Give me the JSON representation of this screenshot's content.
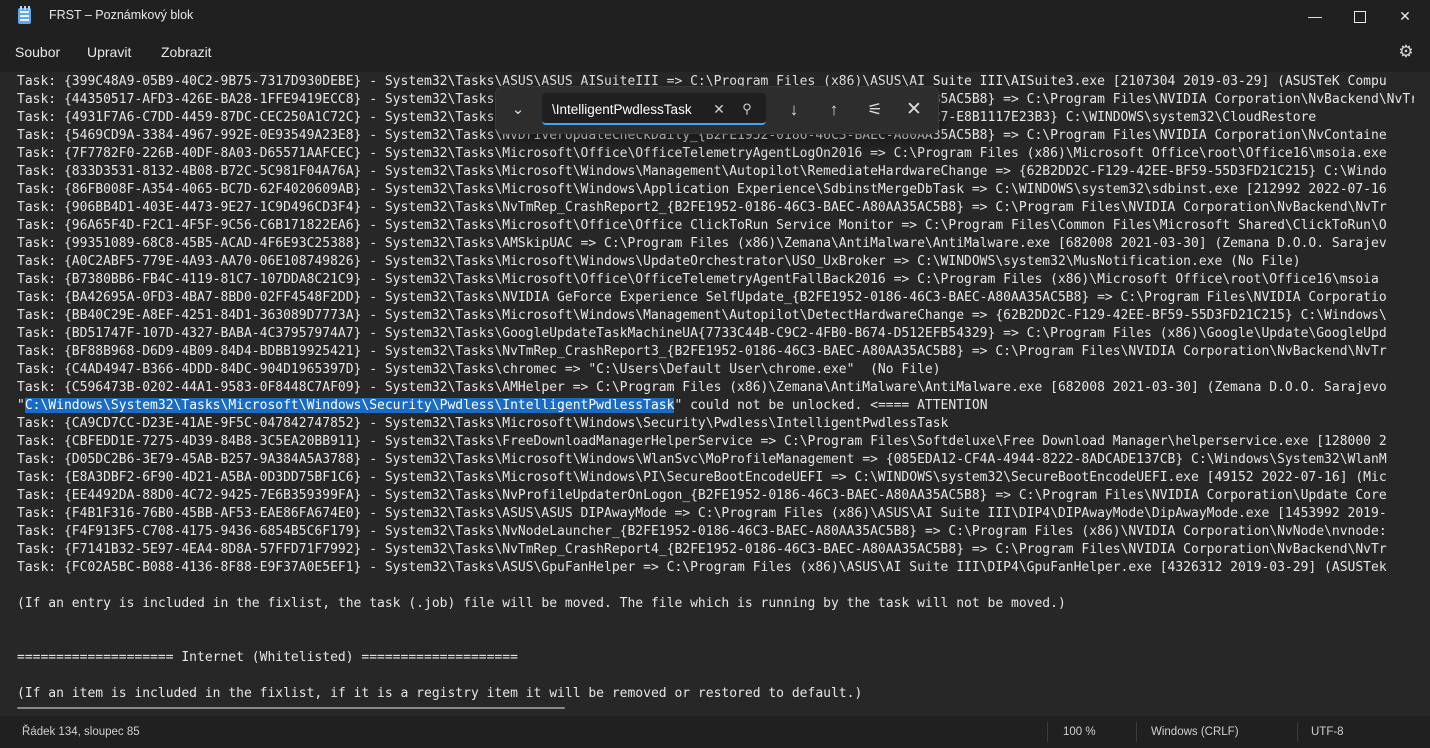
{
  "window": {
    "title": "FRST – Poznámkový blok",
    "minimize_glyph": "—",
    "close_glyph": "✕",
    "icon": "notepad-icon"
  },
  "menu": {
    "file": "Soubor",
    "edit": "Upravit",
    "view": "Zobrazit",
    "settings_icon": "gear-icon"
  },
  "find": {
    "value": "\\IntelligentPwdlessTask",
    "clear_glyph": "✕",
    "search_glyph": "⚲",
    "expand_glyph": "⌄",
    "next_glyph": "↓",
    "prev_glyph": "↑",
    "options_glyph": "⚟",
    "close_glyph": "✕"
  },
  "editor": {
    "lines": [
      "Task: {399C48A9-05B9-40C2-9B75-7317D930DEBE} - System32\\Tasks\\ASUS\\ASUS AISuiteIII => C:\\Program Files (x86)\\ASUS\\AI Suite III\\AISuite3.exe [2107304 2019-03-29] (ASUSTeK Compu",
      "Task: {44350517-AFD3-426E-BA28-1FFE9419ECC8} - System32\\Tasks\\NvDriverUpdateCheckDaily_{B2FE1952-0186-46C3-BAEC-A80AA35AC5B8} => C:\\Program Files\\NVIDIA Corporation\\NvBackend\\NvTr",
      "Task: {4931F7A6-C7DD-4459-87DC-CEC250A1C72C} - System32\\Tasks\\Microsoft\\Windows\\Management\\Provisioning\\{C48D-46B8-BF27-E8B1117E23B3} C:\\WINDOWS\\system32\\CloudRestore",
      "Task: {5469CD9A-3384-4967-992E-0E93549A23E8} - System32\\Tasks\\NvDriverUpdateCheckDaily_{B2FE1952-0186-46C3-BAEC-A80AA35AC5B8} => C:\\Program Files\\NVIDIA Corporation\\NvContaine",
      "Task: {7F7782F0-226B-40DF-8A03-D65571AAFCEC} - System32\\Tasks\\Microsoft\\Office\\OfficeTelemetryAgentLogOn2016 => C:\\Program Files (x86)\\Microsoft Office\\root\\Office16\\msoia.exe",
      "Task: {833D3531-8132-4B08-B72C-5C981F04A76A} - System32\\Tasks\\Microsoft\\Windows\\Management\\Autopilot\\RemediateHardwareChange => {62B2DD2C-F129-42EE-BF59-55D3FD21C215} C:\\Windo",
      "Task: {86FB008F-A354-4065-BC7D-62F4020609AB} - System32\\Tasks\\Microsoft\\Windows\\Application Experience\\SdbinstMergeDbTask => C:\\WINDOWS\\system32\\sdbinst.exe [212992 2022-07-16",
      "Task: {906BB4D1-403E-4473-9E27-1C9D496CD3F4} - System32\\Tasks\\NvTmRep_CrashReport2_{B2FE1952-0186-46C3-BAEC-A80AA35AC5B8} => C:\\Program Files\\NVIDIA Corporation\\NvBackend\\NvTr",
      "Task: {96A65F4D-F2C1-4F5F-9C56-C6B171822EA6} - System32\\Tasks\\Microsoft\\Office\\Office ClickToRun Service Monitor => C:\\Program Files\\Common Files\\Microsoft Shared\\ClickToRun\\O",
      "Task: {99351089-68C8-45B5-ACAD-4F6E93C25388} - System32\\Tasks\\AMSkipUAC => C:\\Program Files (x86)\\Zemana\\AntiMalware\\AntiMalware.exe [682008 2021-03-30] (Zemana D.O.O. Sarajev",
      "Task: {A0C2ABF5-779E-4A93-AA70-06E108749826} - System32\\Tasks\\Microsoft\\Windows\\UpdateOrchestrator\\USO_UxBroker => C:\\WINDOWS\\system32\\MusNotification.exe (No File)",
      "Task: {B7380BB6-FB4C-4119-81C7-107DDA8C21C9} - System32\\Tasks\\Microsoft\\Office\\OfficeTelemetryAgentFallBack2016 => C:\\Program Files (x86)\\Microsoft Office\\root\\Office16\\msoia",
      "Task: {BA42695A-0FD3-4BA7-8BD0-02FF4548F2DD} - System32\\Tasks\\NVIDIA GeForce Experience SelfUpdate_{B2FE1952-0186-46C3-BAEC-A80AA35AC5B8} => C:\\Program Files\\NVIDIA Corporatio",
      "Task: {BB40C29E-A8EF-4251-84D1-363089D7773A} - System32\\Tasks\\Microsoft\\Windows\\Management\\Autopilot\\DetectHardwareChange => {62B2DD2C-F129-42EE-BF59-55D3FD21C215} C:\\Windows\\",
      "Task: {BD51747F-107D-4327-BABA-4C37957974A7} - System32\\Tasks\\GoogleUpdateTaskMachineUA{7733C44B-C9C2-4FB0-B674-D512EFB54329} => C:\\Program Files (x86)\\Google\\Update\\GoogleUpd",
      "Task: {BF88B968-D6D9-4B09-84D4-BDBB19925421} - System32\\Tasks\\NvTmRep_CrashReport3_{B2FE1952-0186-46C3-BAEC-A80AA35AC5B8} => C:\\Program Files\\NVIDIA Corporation\\NvBackend\\NvTr",
      "Task: {C4AD4947-B366-4DDD-84DC-904D1965397D} - System32\\Tasks\\chromec => \"C:\\Users\\Default User\\chrome.exe\"  (No File)",
      "Task: {C596473B-0202-44A1-9583-0F8448C7AF09} - System32\\Tasks\\AMHelper => C:\\Program Files (x86)\\Zemana\\AntiMalware\\AntiMalware.exe [682008 2021-03-30] (Zemana D.O.O. Sarajevo",
      "HIGHLIGHT",
      "Task: {CA9CD7CC-D23E-41AE-9F5C-047842747852} - System32\\Tasks\\Microsoft\\Windows\\Security\\Pwdless\\IntelligentPwdlessTask",
      "Task: {CBFEDD1E-7275-4D39-84B8-3C5EA20BB911} - System32\\Tasks\\FreeDownloadManagerHelperService => C:\\Program Files\\Softdeluxe\\Free Download Manager\\helperservice.exe [128000 2",
      "Task: {D05DC2B6-3E79-45AB-B257-9A384A5A3788} - System32\\Tasks\\Microsoft\\Windows\\WlanSvc\\MoProfileManagement => {085EDA12-CF4A-4944-8222-8ADCADE137CB} C:\\Windows\\System32\\WlanM",
      "Task: {E8A3DBF2-6F90-4D21-A5BA-0D3DD75BF1C6} - System32\\Tasks\\Microsoft\\Windows\\PI\\SecureBootEncodeUEFI => C:\\WINDOWS\\system32\\SecureBootEncodeUEFI.exe [49152 2022-07-16] (Mic",
      "Task: {EE4492DA-88D0-4C72-9425-7E6B359399FA} - System32\\Tasks\\NvProfileUpdaterOnLogon_{B2FE1952-0186-46C3-BAEC-A80AA35AC5B8} => C:\\Program Files\\NVIDIA Corporation\\Update Core",
      "Task: {F4B1F316-76B0-45BB-AF53-EAE86FA674E0} - System32\\Tasks\\ASUS\\ASUS DIPAwayMode => C:\\Program Files (x86)\\ASUS\\AI Suite III\\DIP4\\DIPAwayMode\\DipAwayMode.exe [1453992 2019-",
      "Task: {F4F913F5-C708-4175-9436-6854B5C6F179} - System32\\Tasks\\NvNodeLauncher_{B2FE1952-0186-46C3-BAEC-A80AA35AC5B8} => C:\\Program Files (x86)\\NVIDIA Corporation\\NvNode\\nvnode:",
      "Task: {F7141B32-5E97-4EA4-8D8A-57FFD71F7992} - System32\\Tasks\\NvTmRep_CrashReport4_{B2FE1952-0186-46C3-BAEC-A80AA35AC5B8} => C:\\Program Files\\NVIDIA Corporation\\NvBackend\\NvTr",
      "Task: {FC02A5BC-B088-4136-8F88-E9F37A0E5EF1} - System32\\Tasks\\ASUS\\GpuFanHelper => C:\\Program Files (x86)\\ASUS\\AI Suite III\\DIP4\\GpuFanHelper.exe [4326312 2019-03-29] (ASUSTek",
      "",
      "(If an entry is included in the fixlist, the task (.job) file will be moved. The file which is running by the task will not be moved.)",
      "",
      "",
      "==================== Internet (Whitelisted) ====================",
      "",
      "(If an item is included in the fixlist, if it is a registry item it will be removed or restored to default.)"
    ],
    "highlight_pre": "\"",
    "highlight_sel": "C:\\Windows\\System32\\Tasks\\Microsoft\\Windows\\Security\\Pwdless\\IntelligentPwdlessTask",
    "highlight_post": "\" could not be unlocked. <==== ATTENTION"
  },
  "status": {
    "position": "Řádek 134, sloupec 85",
    "zoom": "100 %",
    "line_endings": "Windows (CRLF)",
    "encoding": "UTF-8"
  }
}
